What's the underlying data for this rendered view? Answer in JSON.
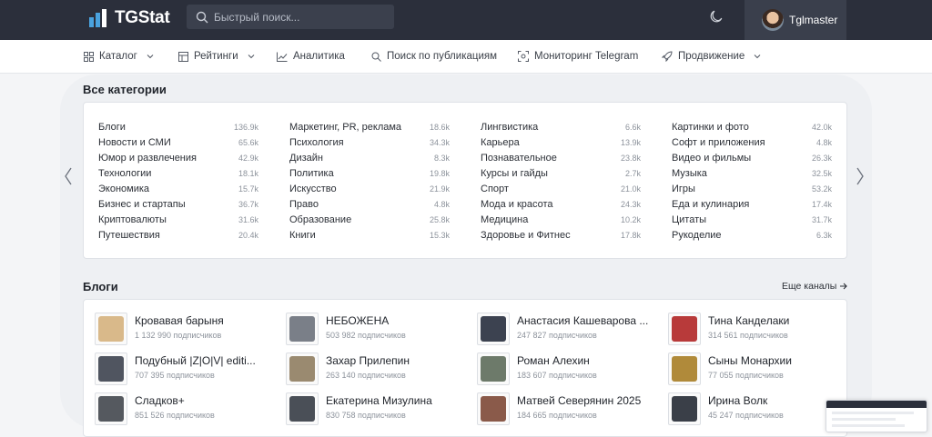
{
  "app": {
    "logo_text": "TGStat"
  },
  "search": {
    "placeholder": "Быстрый поиск..."
  },
  "user": {
    "name": "Tglmaster"
  },
  "nav": {
    "items": [
      {
        "label": "Каталог",
        "icon": "grid-icon",
        "dropdown": true
      },
      {
        "label": "Рейтинги",
        "icon": "table-icon",
        "dropdown": true
      },
      {
        "label": "Аналитика",
        "icon": "chart-line-icon",
        "dropdown": false
      },
      {
        "label": "Поиск по публикациям",
        "icon": "search-doc-icon",
        "dropdown": false
      },
      {
        "label": "Мониторинг Telegram",
        "icon": "scan-icon",
        "dropdown": false
      },
      {
        "label": "Продвижение",
        "icon": "rocket-icon",
        "dropdown": true
      }
    ]
  },
  "categories": {
    "title": "Все категории",
    "columns": [
      [
        {
          "name": "Блоги",
          "count": "136.9k"
        },
        {
          "name": "Новости и СМИ",
          "count": "65.6k"
        },
        {
          "name": "Юмор и развлечения",
          "count": "42.9k"
        },
        {
          "name": "Технологии",
          "count": "18.1k"
        },
        {
          "name": "Экономика",
          "count": "15.7k"
        },
        {
          "name": "Бизнес и стартапы",
          "count": "36.7k"
        },
        {
          "name": "Криптовалюты",
          "count": "31.6k"
        },
        {
          "name": "Путешествия",
          "count": "20.4k"
        }
      ],
      [
        {
          "name": "Маркетинг, PR, реклама",
          "count": "18.6k"
        },
        {
          "name": "Психология",
          "count": "34.3k"
        },
        {
          "name": "Дизайн",
          "count": "8.3k"
        },
        {
          "name": "Политика",
          "count": "19.8k"
        },
        {
          "name": "Искусство",
          "count": "21.9k"
        },
        {
          "name": "Право",
          "count": "4.8k"
        },
        {
          "name": "Образование",
          "count": "25.8k"
        },
        {
          "name": "Книги",
          "count": "15.3k"
        }
      ],
      [
        {
          "name": "Лингвистика",
          "count": "6.6k"
        },
        {
          "name": "Карьера",
          "count": "13.9k"
        },
        {
          "name": "Познавательное",
          "count": "23.8k"
        },
        {
          "name": "Курсы и гайды",
          "count": "2.7k"
        },
        {
          "name": "Спорт",
          "count": "21.0k"
        },
        {
          "name": "Мода и красота",
          "count": "24.3k"
        },
        {
          "name": "Медицина",
          "count": "10.2k"
        },
        {
          "name": "Здоровье и Фитнес",
          "count": "17.8k"
        }
      ],
      [
        {
          "name": "Картинки и фото",
          "count": "42.0k"
        },
        {
          "name": "Софт и приложения",
          "count": "4.8k"
        },
        {
          "name": "Видео и фильмы",
          "count": "26.3k"
        },
        {
          "name": "Музыка",
          "count": "32.5k"
        },
        {
          "name": "Игры",
          "count": "53.2k"
        },
        {
          "name": "Еда и кулинария",
          "count": "17.4k"
        },
        {
          "name": "Цитаты",
          "count": "31.7k"
        },
        {
          "name": "Рукоделие",
          "count": "6.3k"
        }
      ]
    ]
  },
  "blogs": {
    "title": "Блоги",
    "more_label": "Еще каналы",
    "channels": [
      {
        "name": "Кровавая барыня",
        "subs": "1 132 990 подписчиков",
        "thumb_color": "#d9b98a"
      },
      {
        "name": "НЕБОЖЕНА",
        "subs": "503 982 подписчиков",
        "thumb_color": "#7a7f88"
      },
      {
        "name": "Анастасия Кашеварова ...",
        "subs": "247 827 подписчиков",
        "thumb_color": "#3c4250"
      },
      {
        "name": "Тина Канделаки",
        "subs": "314 561 подписчиков",
        "thumb_color": "#b83a3a"
      },
      {
        "name": "Подубный |Z|O|V| editi...",
        "subs": "707 395 подписчиков",
        "thumb_color": "#505560"
      },
      {
        "name": "Захар Прилепин",
        "subs": "263 140 подписчиков",
        "thumb_color": "#9a8a70"
      },
      {
        "name": "Роман Алехин",
        "subs": "183 607 подписчиков",
        "thumb_color": "#6d7a6a"
      },
      {
        "name": "Сыны Монархии",
        "subs": "77 055 подписчиков",
        "thumb_color": "#b08a3a"
      },
      {
        "name": "Сладков+",
        "subs": "851 526 подписчиков",
        "thumb_color": "#55595f"
      },
      {
        "name": "Екатерина Мизулина",
        "subs": "830 758 подписчиков",
        "thumb_color": "#4a4f57"
      },
      {
        "name": "Матвей Северянин 2025",
        "subs": "184 665 подписчиков",
        "thumb_color": "#8a5a4a"
      },
      {
        "name": "Ирина Волк",
        "subs": "45 247 подписчиков",
        "thumb_color": "#3a3f48"
      }
    ]
  }
}
